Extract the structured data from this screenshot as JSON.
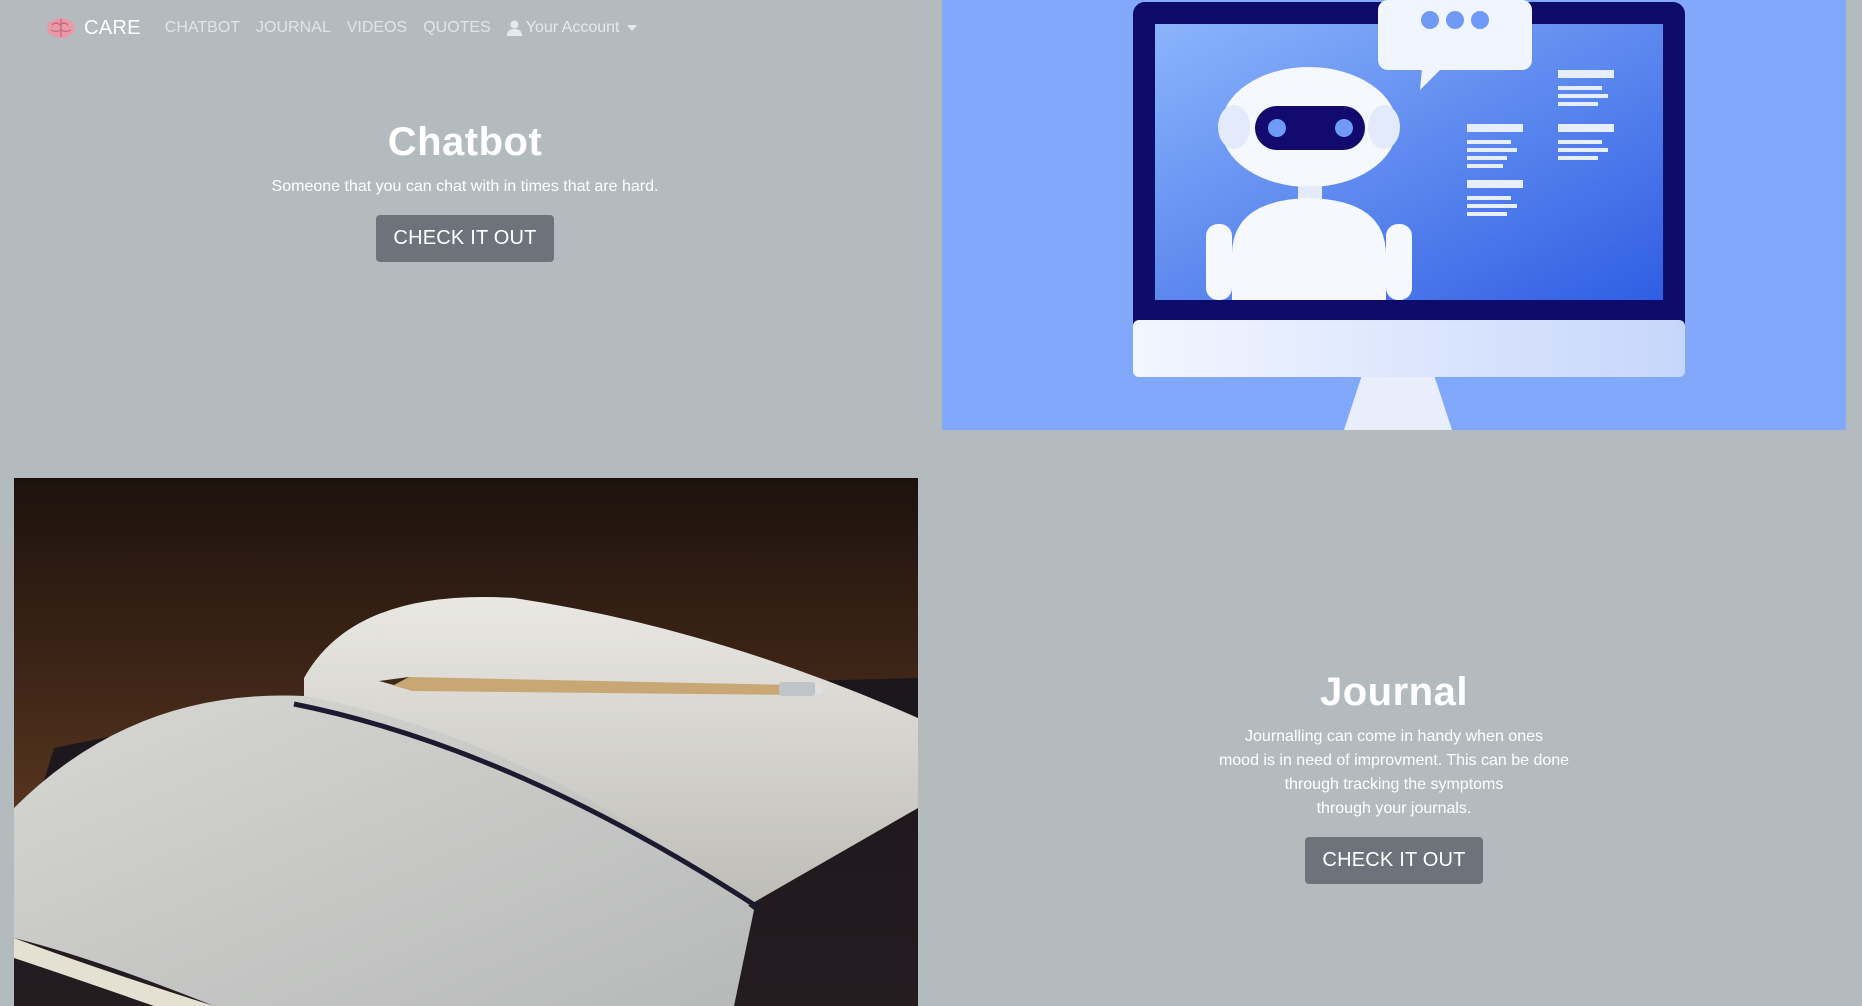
{
  "nav": {
    "brand": "CARE",
    "links": [
      "CHATBOT",
      "JOURNAL",
      "VIDEOS",
      "QUOTES"
    ],
    "account": "Your Account"
  },
  "chatbot": {
    "title": "Chatbot",
    "description": "Someone that you can chat with in times that are hard.",
    "button": "CHECK IT OUT"
  },
  "journal": {
    "title": "Journal",
    "description_lines": [
      "Journalling can come in handy when ones",
      "mood is in need of improvment. This can be done",
      "through tracking the symptoms",
      "through your journals."
    ],
    "button": "CHECK IT OUT"
  },
  "colors": {
    "background": "#b4bbbe",
    "button": "#6c737a",
    "robot_bg": "#82a8fb"
  },
  "icons": {
    "brand": "brain-icon",
    "account": "user-icon",
    "dropdown": "caret-down-icon"
  }
}
